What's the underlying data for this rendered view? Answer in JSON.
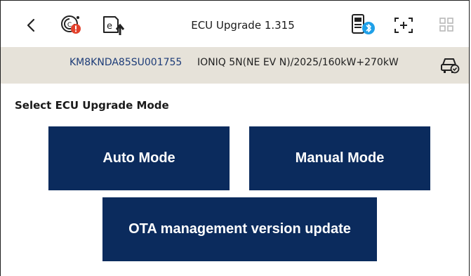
{
  "header": {
    "title": "ECU Upgrade 1.315",
    "icons": {
      "back": "back-chevron",
      "diagnostic": "diagnostic-alert",
      "upgrade": "ecu-upgrade",
      "vci": "vci-bluetooth",
      "capture": "screen-capture",
      "grid": "app-grid"
    }
  },
  "vehicle": {
    "vin": "KM8KNDA85SU001755",
    "model": "IONIQ 5N(NE EV N)/2025/160kW+270kW"
  },
  "main": {
    "section_label": "Select ECU Upgrade Mode",
    "buttons": {
      "auto": "Auto Mode",
      "manual": "Manual Mode",
      "ota": "OTA management version update"
    }
  },
  "colors": {
    "button_bg": "#0b2b5d",
    "vin_color": "#1d3c78",
    "info_bar": "#e6e2d9",
    "alert": "#e2412c",
    "bluetooth": "#1fa0e8"
  }
}
